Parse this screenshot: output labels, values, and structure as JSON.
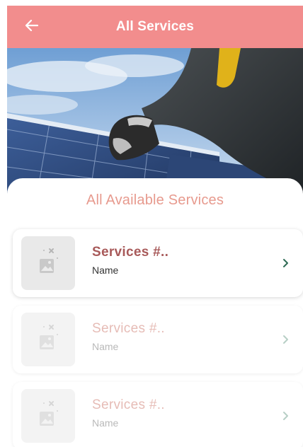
{
  "header": {
    "title": "All Services",
    "back_icon": "arrow-left-icon",
    "background": "#f28d8d"
  },
  "hero": {
    "icon": "solar-panel-worker-photo"
  },
  "main": {
    "section_title": "All Available Services",
    "services": [
      {
        "title": "Services #..",
        "name": "Name",
        "state": "active",
        "thumb_icon": "image-placeholder-icon",
        "action_icon": "chevron-right-icon"
      },
      {
        "title": "Services #..",
        "name": "Name",
        "state": "loading",
        "thumb_icon": "image-placeholder-icon",
        "action_icon": "chevron-right-icon"
      },
      {
        "title": "Services #..",
        "name": "Name",
        "state": "loading",
        "thumb_icon": "image-placeholder-icon",
        "action_icon": "chevron-right-icon"
      }
    ]
  },
  "colors": {
    "accent": "#f28d8d",
    "section_title": "#e79a8e",
    "service_title": "#a85a5a",
    "chevron": "#2f6b55"
  }
}
